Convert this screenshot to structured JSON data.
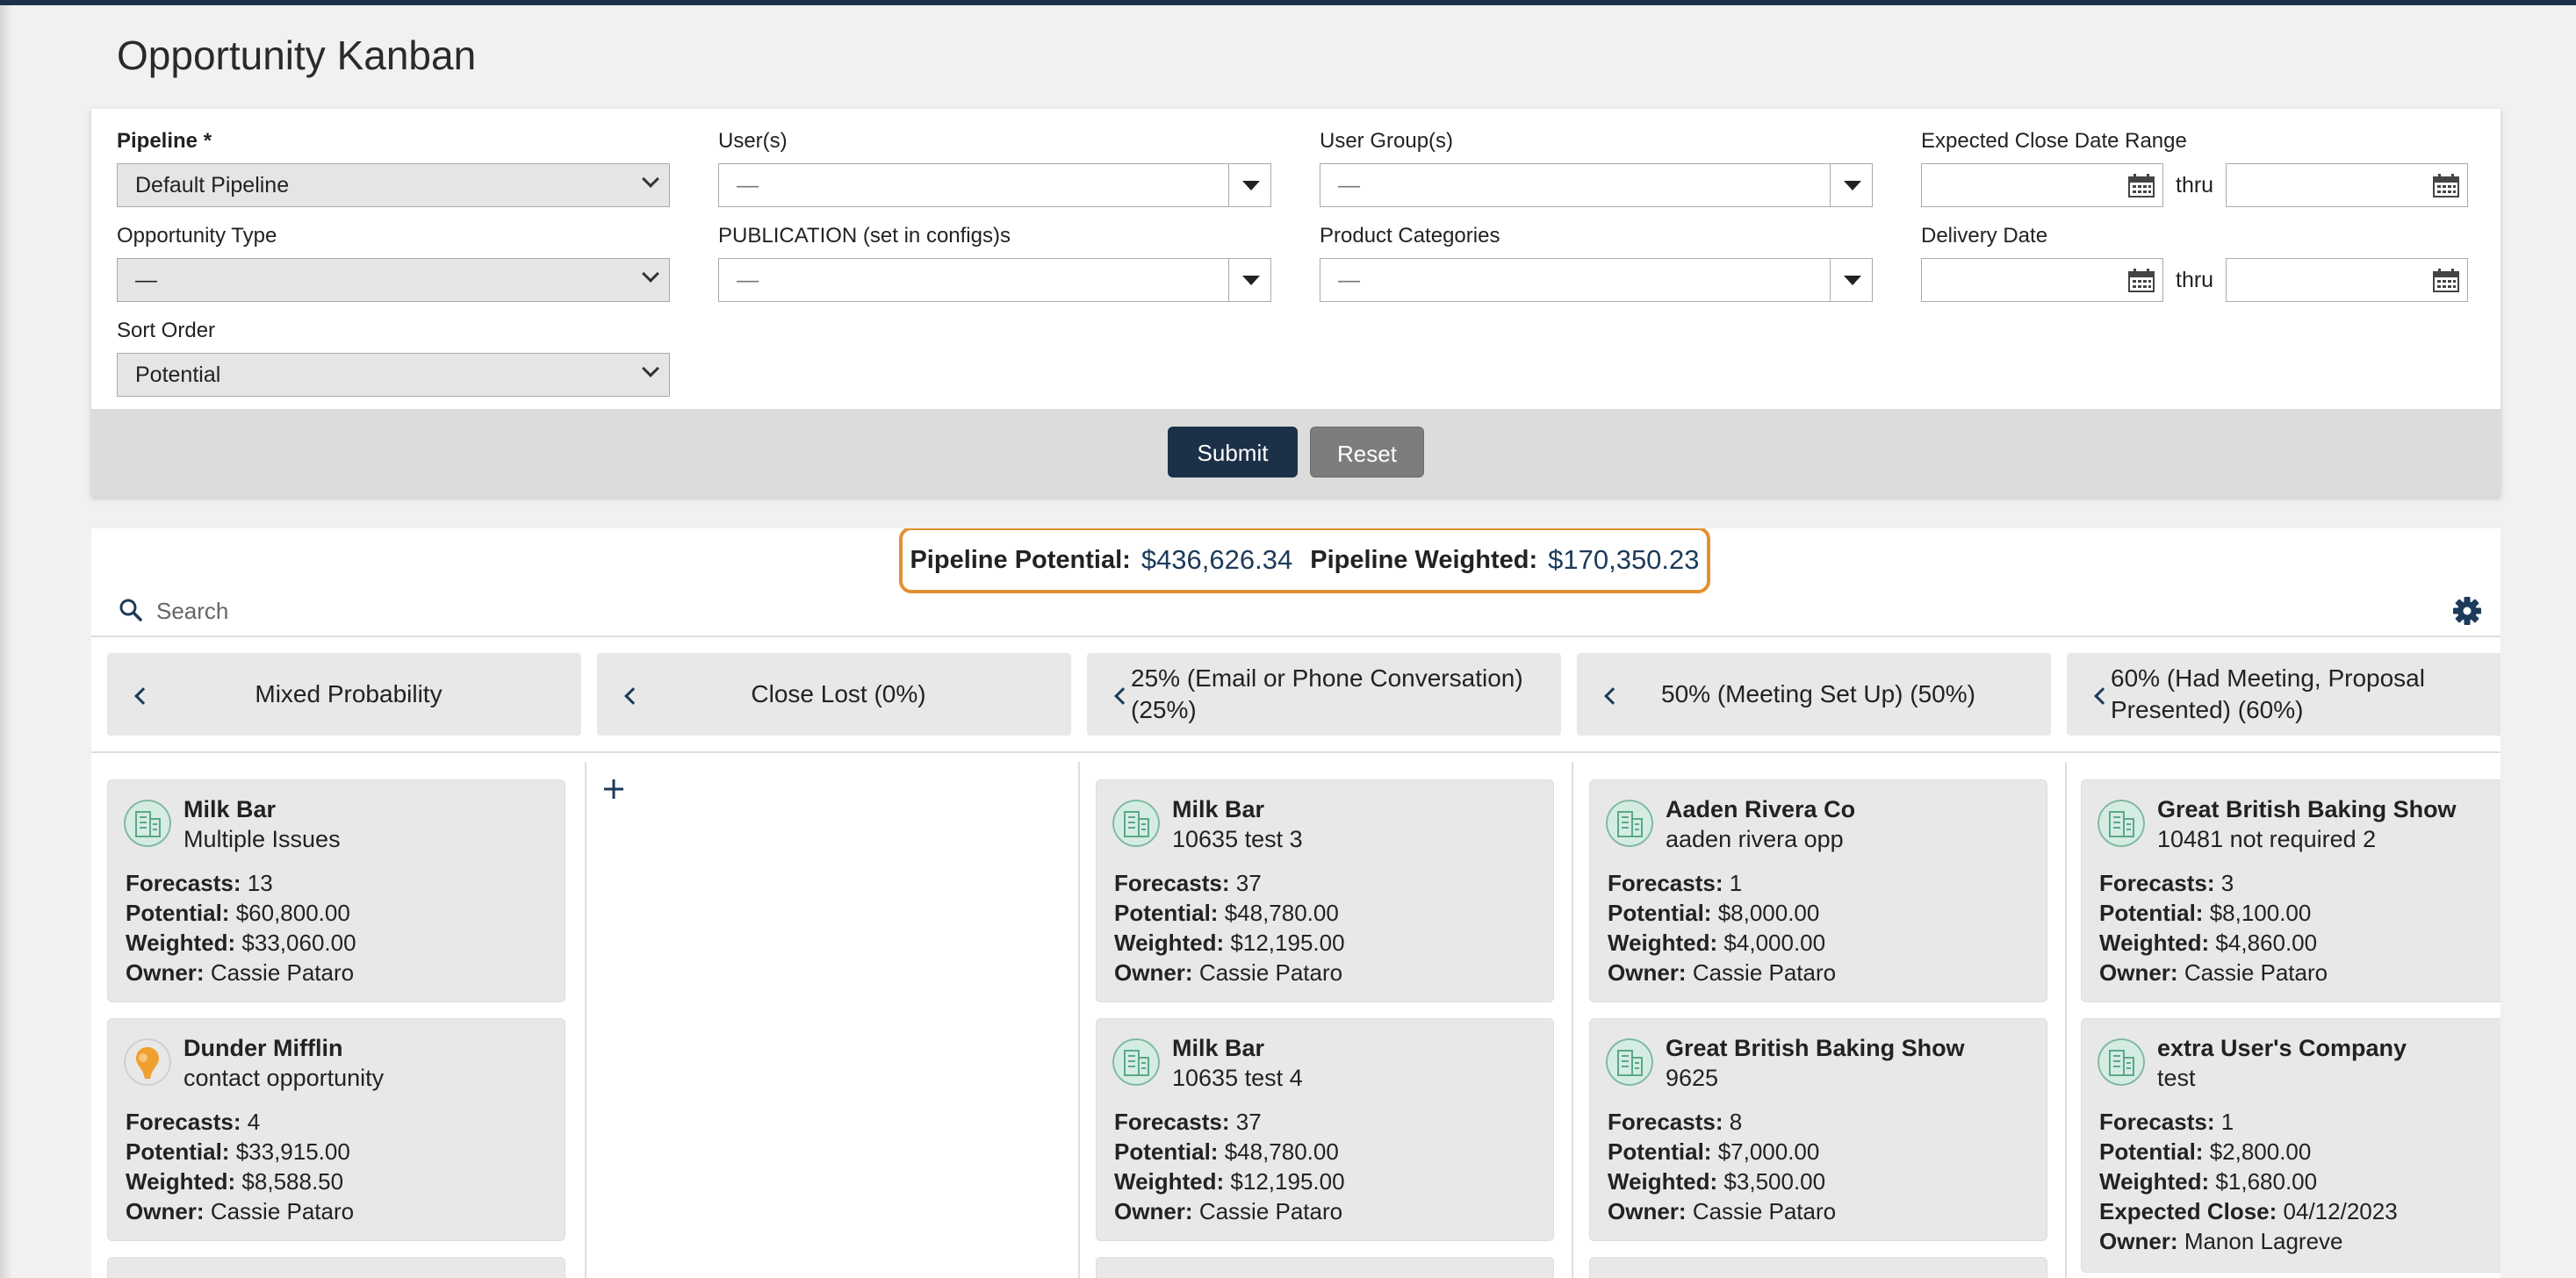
{
  "page": {
    "title": "Opportunity Kanban"
  },
  "filters": {
    "pipeline": {
      "label": "Pipeline",
      "required_mark": " *",
      "value": "Default Pipeline"
    },
    "users": {
      "label": "User(s)",
      "value": "—"
    },
    "user_groups": {
      "label": "User Group(s)",
      "value": "—"
    },
    "expected_close": {
      "label": "Expected Close Date Range",
      "thru": "thru"
    },
    "opportunity_type": {
      "label": "Opportunity Type",
      "value": "—"
    },
    "publication": {
      "label": "PUBLICATION (set in configs)s",
      "value": "—"
    },
    "product_categories": {
      "label": "Product Categories",
      "value": "—"
    },
    "delivery_date": {
      "label": "Delivery Date",
      "thru": "thru"
    },
    "sort_order": {
      "label": "Sort Order",
      "value": "Potential"
    },
    "submit_label": "Submit",
    "reset_label": "Reset"
  },
  "totals": {
    "potential_label": "Pipeline Potential:",
    "potential_value": "$436,626.34",
    "weighted_label": "Pipeline Weighted:",
    "weighted_value": "$170,350.23"
  },
  "search": {
    "placeholder": "Search"
  },
  "columns": [
    {
      "title": "Mixed Probability"
    },
    {
      "title": "Close Lost (0%)"
    },
    {
      "title": "25% (Email or Phone Conversation) (25%)"
    },
    {
      "title": "50% (Meeting Set Up) (50%)"
    },
    {
      "title": "60% (Had Meeting, Proposal Presented) (60%)"
    }
  ],
  "field_labels": {
    "forecasts": "Forecasts:",
    "potential": "Potential:",
    "weighted": "Weighted:",
    "owner": "Owner:",
    "expected_close": "Expected Close:"
  },
  "cards": {
    "c0_0": {
      "name": "Milk Bar",
      "sub": "Multiple Issues",
      "forecasts": "13",
      "potential": "$60,800.00",
      "weighted": "$33,060.00",
      "owner": "Cassie Pataro",
      "icon": "building-icon"
    },
    "c0_1": {
      "name": "Dunder Mifflin",
      "sub": "contact opportunity",
      "forecasts": "4",
      "potential": "$33,915.00",
      "weighted": "$8,588.50",
      "owner": "Cassie Pataro",
      "icon": "contact-avatar-icon"
    },
    "c2_0": {
      "name": "Milk Bar",
      "sub": "10635 test 3",
      "forecasts": "37",
      "potential": "$48,780.00",
      "weighted": "$12,195.00",
      "owner": "Cassie Pataro",
      "icon": "building-icon"
    },
    "c2_1": {
      "name": "Milk Bar",
      "sub": "10635 test 4",
      "forecasts": "37",
      "potential": "$48,780.00",
      "weighted": "$12,195.00",
      "owner": "Cassie Pataro",
      "icon": "building-icon"
    },
    "c3_0": {
      "name": "Aaden Rivera Co",
      "sub": "aaden rivera opp",
      "forecasts": "1",
      "potential": "$8,000.00",
      "weighted": "$4,000.00",
      "owner": "Cassie Pataro",
      "icon": "building-icon"
    },
    "c3_1": {
      "name": "Great British Baking Show",
      "sub": "9625",
      "forecasts": "8",
      "potential": "$7,000.00",
      "weighted": "$3,500.00",
      "owner": "Cassie Pataro",
      "icon": "building-icon"
    },
    "c4_0": {
      "name": "Great British Baking Show",
      "sub": "10481 not required 2",
      "forecasts": "3",
      "potential": "$8,100.00",
      "weighted": "$4,860.00",
      "owner": "Cassie Pataro",
      "icon": "building-icon"
    },
    "c4_1": {
      "name": "extra User's Company",
      "sub": "test",
      "forecasts": "1",
      "potential": "$2,800.00",
      "weighted": "$1,680.00",
      "expected_close": "04/12/2023",
      "owner": "Manon Lagreve",
      "icon": "building-icon"
    }
  },
  "colors": {
    "navy": "#1c3048",
    "highlight": "#e09030",
    "icon_green": "#5aa88a"
  }
}
